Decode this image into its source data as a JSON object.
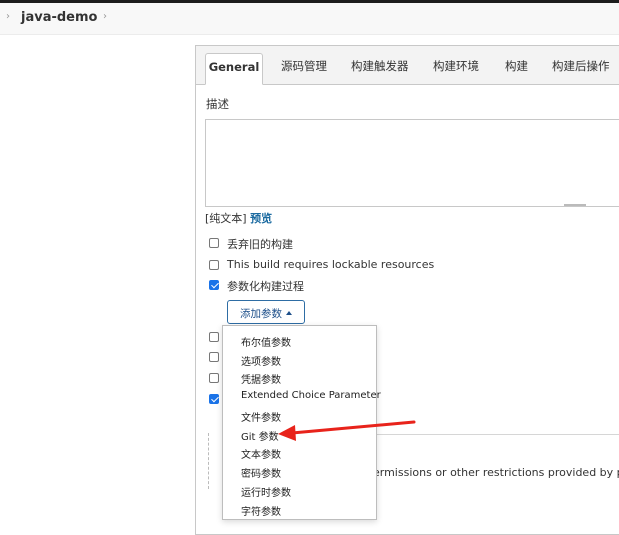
{
  "breadcrumb": {
    "project": "java-demo"
  },
  "tabs": [
    "General",
    "源码管理",
    "构建触发器",
    "构建环境",
    "构建",
    "构建后操作"
  ],
  "description": {
    "label": "描述",
    "plain_text": "[纯文本]",
    "preview": "预览"
  },
  "options": [
    {
      "label": "丢弃旧的构建",
      "checked": false
    },
    {
      "label": "This build requires lockable resources",
      "checked": false
    },
    {
      "label": "参数化构建过程",
      "checked": true
    }
  ],
  "add_param_button": "添加参数",
  "hidden_checkboxes": [
    false,
    false,
    false,
    true
  ],
  "param_menu": [
    "布尔值参数",
    "选项参数",
    "凭据参数",
    "Extended Choice Parameter",
    "文件参数",
    "Git 参数",
    "文本参数",
    "密码参数",
    "运行时参数",
    "字符参数"
  ],
  "bottom_text": "ermissions or other restrictions provided by plugi",
  "colors": {
    "accent": "#1a73e8",
    "arrow": "#e8231b",
    "link": "#1a6aa0"
  }
}
